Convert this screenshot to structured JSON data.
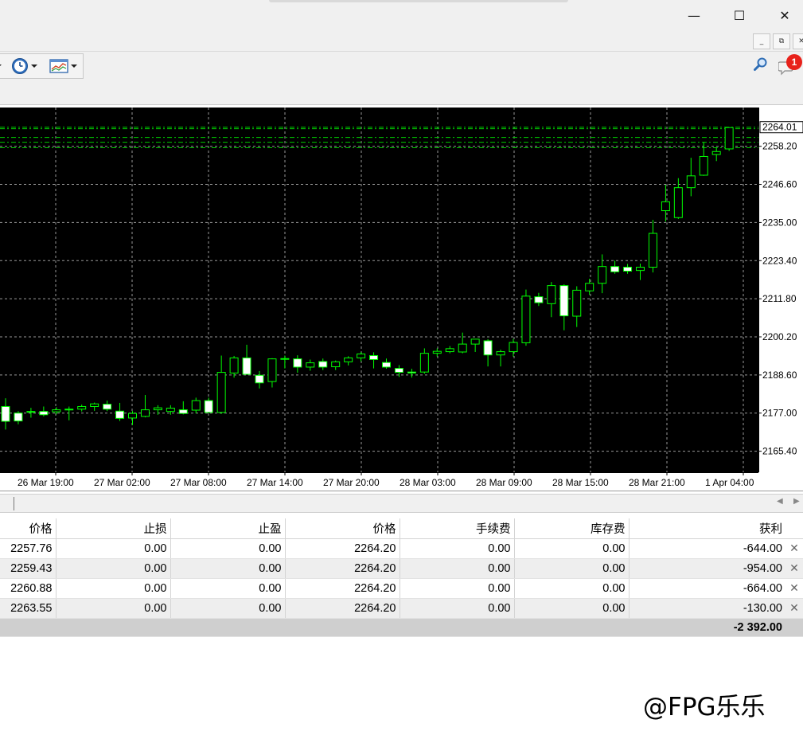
{
  "window": {
    "minimize_glyph": "—",
    "maximize_glyph": "☐",
    "close_glyph": "✕",
    "mdi_minimize_glyph": "_",
    "mdi_restore_glyph": "⧉",
    "mdi_close_glyph": "✕"
  },
  "toolbar": {
    "items": [
      {
        "icon": "clock-icon"
      },
      {
        "icon": "chart-template-icon"
      }
    ],
    "right_icons": [
      "search-icon",
      "chat-icon"
    ],
    "notification_count": "1"
  },
  "colors": {
    "chart_bg": "#000000",
    "grid": "#c0c0c0",
    "candle_outline": "#00ff00",
    "bull_body": "#000000",
    "bear_body": "#ffffff",
    "order_lines": "#00c800",
    "notification_badge": "#e8221b"
  },
  "chart_data": {
    "type": "candlestick",
    "ylim": [
      2159.0,
      2270.0
    ],
    "current_price_label": "2264.01",
    "y_ticks": [
      "2258.20",
      "2246.60",
      "2235.00",
      "2223.40",
      "2211.80",
      "2200.20",
      "2188.60",
      "2177.00",
      "2165.40"
    ],
    "x_ticks": [
      "26 Mar 19:00",
      "27 Mar 02:00",
      "27 Mar 08:00",
      "27 Mar 14:00",
      "27 Mar 20:00",
      "28 Mar 03:00",
      "28 Mar 09:00",
      "28 Mar 15:00",
      "28 Mar 21:00",
      "1 Apr 04:00"
    ],
    "order_levels": [
      2264.0,
      2263.55,
      2260.88,
      2259.43,
      2257.76
    ],
    "candles": [
      {
        "o": 2179.0,
        "h": 2181.5,
        "l": 2172.0,
        "c": 2174.5
      },
      {
        "o": 2177.0,
        "h": 2177.6,
        "l": 2173.6,
        "c": 2174.6
      },
      {
        "o": 2177.4,
        "h": 2178.6,
        "l": 2175.6,
        "c": 2177.5
      },
      {
        "o": 2177.5,
        "h": 2179.0,
        "l": 2176.0,
        "c": 2176.5
      },
      {
        "o": 2177.4,
        "h": 2178.8,
        "l": 2176.6,
        "c": 2178.0
      },
      {
        "o": 2178.0,
        "h": 2179.0,
        "l": 2174.8,
        "c": 2178.2
      },
      {
        "o": 2178.2,
        "h": 2179.6,
        "l": 2177.5,
        "c": 2179.0
      },
      {
        "o": 2179.0,
        "h": 2180.2,
        "l": 2177.7,
        "c": 2179.8
      },
      {
        "o": 2179.7,
        "h": 2180.8,
        "l": 2177.6,
        "c": 2178.2
      },
      {
        "o": 2177.6,
        "h": 2180.1,
        "l": 2174.6,
        "c": 2175.4
      },
      {
        "o": 2175.5,
        "h": 2177.6,
        "l": 2173.4,
        "c": 2176.9
      },
      {
        "o": 2176.0,
        "h": 2182.5,
        "l": 2175.7,
        "c": 2178.0
      },
      {
        "o": 2178.0,
        "h": 2179.4,
        "l": 2176.5,
        "c": 2178.6
      },
      {
        "o": 2177.5,
        "h": 2179.4,
        "l": 2176.5,
        "c": 2178.5
      },
      {
        "o": 2178.0,
        "h": 2180.6,
        "l": 2176.6,
        "c": 2176.9
      },
      {
        "o": 2177.9,
        "h": 2181.7,
        "l": 2176.9,
        "c": 2180.8
      },
      {
        "o": 2180.8,
        "h": 2181.7,
        "l": 2177.5,
        "c": 2177.2
      },
      {
        "o": 2177.2,
        "h": 2194.5,
        "l": 2176.8,
        "c": 2189.4
      },
      {
        "o": 2189.2,
        "h": 2194.4,
        "l": 2187.8,
        "c": 2193.8
      },
      {
        "o": 2193.8,
        "h": 2197.8,
        "l": 2189.3,
        "c": 2188.8
      },
      {
        "o": 2188.5,
        "h": 2189.8,
        "l": 2184.5,
        "c": 2186.2
      },
      {
        "o": 2186.6,
        "h": 2193.7,
        "l": 2184.8,
        "c": 2193.5
      },
      {
        "o": 2193.6,
        "h": 2194.5,
        "l": 2190.6,
        "c": 2193.5
      },
      {
        "o": 2193.5,
        "h": 2194.6,
        "l": 2189.3,
        "c": 2191.0
      },
      {
        "o": 2191.0,
        "h": 2193.3,
        "l": 2189.9,
        "c": 2192.3
      },
      {
        "o": 2192.7,
        "h": 2193.6,
        "l": 2190.1,
        "c": 2191.0
      },
      {
        "o": 2191.1,
        "h": 2193.0,
        "l": 2190.1,
        "c": 2192.6
      },
      {
        "o": 2192.6,
        "h": 2194.3,
        "l": 2191.5,
        "c": 2193.8
      },
      {
        "o": 2193.8,
        "h": 2195.6,
        "l": 2192.7,
        "c": 2195.0
      },
      {
        "o": 2194.5,
        "h": 2195.5,
        "l": 2190.6,
        "c": 2193.3
      },
      {
        "o": 2192.4,
        "h": 2193.6,
        "l": 2190.5,
        "c": 2191.0
      },
      {
        "o": 2190.6,
        "h": 2191.6,
        "l": 2188.0,
        "c": 2189.4
      },
      {
        "o": 2189.5,
        "h": 2190.5,
        "l": 2187.8,
        "c": 2189.2
      },
      {
        "o": 2189.5,
        "h": 2196.7,
        "l": 2189.0,
        "c": 2195.2
      },
      {
        "o": 2195.2,
        "h": 2196.7,
        "l": 2194.2,
        "c": 2195.8
      },
      {
        "o": 2195.7,
        "h": 2197.4,
        "l": 2195.2,
        "c": 2196.6
      },
      {
        "o": 2195.6,
        "h": 2201.5,
        "l": 2195.2,
        "c": 2198.0
      },
      {
        "o": 2198.0,
        "h": 2199.5,
        "l": 2195.6,
        "c": 2199.5
      },
      {
        "o": 2199.0,
        "h": 2199.5,
        "l": 2191.2,
        "c": 2194.7
      },
      {
        "o": 2194.7,
        "h": 2196.3,
        "l": 2191.2,
        "c": 2195.7
      },
      {
        "o": 2195.7,
        "h": 2199.6,
        "l": 2194.2,
        "c": 2198.5
      },
      {
        "o": 2198.4,
        "h": 2214.6,
        "l": 2197.5,
        "c": 2212.6
      },
      {
        "o": 2212.4,
        "h": 2213.6,
        "l": 2209.6,
        "c": 2210.6
      },
      {
        "o": 2210.3,
        "h": 2216.9,
        "l": 2206.2,
        "c": 2215.8
      },
      {
        "o": 2215.8,
        "h": 2216.2,
        "l": 2202.2,
        "c": 2206.6
      },
      {
        "o": 2206.5,
        "h": 2215.6,
        "l": 2203.2,
        "c": 2214.4
      },
      {
        "o": 2214.2,
        "h": 2217.9,
        "l": 2213.0,
        "c": 2216.5
      },
      {
        "o": 2216.5,
        "h": 2225.3,
        "l": 2213.5,
        "c": 2221.6
      },
      {
        "o": 2221.6,
        "h": 2223.4,
        "l": 2219.4,
        "c": 2220.0
      },
      {
        "o": 2221.4,
        "h": 2222.4,
        "l": 2219.4,
        "c": 2220.2
      },
      {
        "o": 2220.4,
        "h": 2222.5,
        "l": 2217.5,
        "c": 2221.4
      },
      {
        "o": 2221.4,
        "h": 2235.8,
        "l": 2219.8,
        "c": 2231.7
      },
      {
        "o": 2238.6,
        "h": 2246.5,
        "l": 2235.3,
        "c": 2241.3
      },
      {
        "o": 2236.5,
        "h": 2248.5,
        "l": 2236.1,
        "c": 2245.6
      },
      {
        "o": 2245.6,
        "h": 2254.7,
        "l": 2243.0,
        "c": 2249.2
      },
      {
        "o": 2249.4,
        "h": 2259.5,
        "l": 2249.2,
        "c": 2255.1
      },
      {
        "o": 2255.7,
        "h": 2257.9,
        "l": 2253.7,
        "c": 2256.6
      },
      {
        "o": 2257.4,
        "h": 2264.0,
        "l": 2256.8,
        "c": 2263.9
      }
    ]
  },
  "table": {
    "columns": [
      "价格",
      "止损",
      "止盈",
      "价格",
      "手续费",
      "库存费",
      "获利"
    ],
    "rows": [
      {
        "open": "2257.76",
        "sl": "0.00",
        "tp": "0.00",
        "price": "2264.20",
        "commission": "0.00",
        "swap": "0.00",
        "profit": "-644.00"
      },
      {
        "open": "2259.43",
        "sl": "0.00",
        "tp": "0.00",
        "price": "2264.20",
        "commission": "0.00",
        "swap": "0.00",
        "profit": "-954.00"
      },
      {
        "open": "2260.88",
        "sl": "0.00",
        "tp": "0.00",
        "price": "2264.20",
        "commission": "0.00",
        "swap": "0.00",
        "profit": "-664.00"
      },
      {
        "open": "2263.55",
        "sl": "0.00",
        "tp": "0.00",
        "price": "2264.20",
        "commission": "0.00",
        "swap": "0.00",
        "profit": "-130.00"
      }
    ],
    "total_profit": "-2 392.00",
    "close_glyph": "✕"
  },
  "watermark": "@FPG乐乐"
}
